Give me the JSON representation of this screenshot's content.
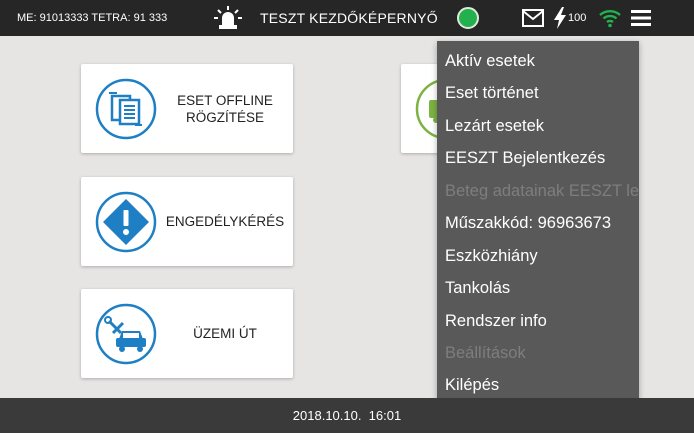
{
  "topbar": {
    "me_text": "ME:  91013333   TETRA:  91 333",
    "title": "TESZT KEZDŐKÉPERNYŐ",
    "battery_level": "100",
    "status_color": "#22b14c",
    "icons": [
      "siren-icon",
      "status-indicator",
      "mail-icon",
      "lightning-icon",
      "wifi-icon",
      "hamburger-menu-icon"
    ]
  },
  "tiles": [
    {
      "label": "ESET OFFLINE\nRÖGZÍTÉSE",
      "icon": "document-copy-icon",
      "color": "#1e7fc5"
    },
    {
      "label": "ENGEDÉLYKÉRÉS",
      "icon": "warning-icon",
      "color": "#1e7fc5"
    },
    {
      "label": "ÜZEMI ÚT",
      "icon": "car-tools-icon",
      "color": "#1e7fc5"
    },
    {
      "label": "",
      "icon": "ambulance-icon",
      "color": "#7cb342"
    }
  ],
  "menu": {
    "items": [
      {
        "label": "Aktív esetek",
        "enabled": true
      },
      {
        "label": "Eset történet",
        "enabled": true
      },
      {
        "label": "Lezárt esetek",
        "enabled": true
      },
      {
        "label": "EESZT Bejelentkezés",
        "enabled": true
      },
      {
        "label": "Beteg adatainak EESZT le",
        "enabled": false
      },
      {
        "label": "Műszakkód: 96963673",
        "enabled": true
      },
      {
        "label": "Eszközhiány",
        "enabled": true
      },
      {
        "label": "Tankolás",
        "enabled": true
      },
      {
        "label": "Rendszer info",
        "enabled": true
      },
      {
        "label": "Beállítások",
        "enabled": false
      },
      {
        "label": "Kilépés",
        "enabled": true
      }
    ]
  },
  "footer": {
    "datetime": "2018.10.10.  16:01"
  }
}
